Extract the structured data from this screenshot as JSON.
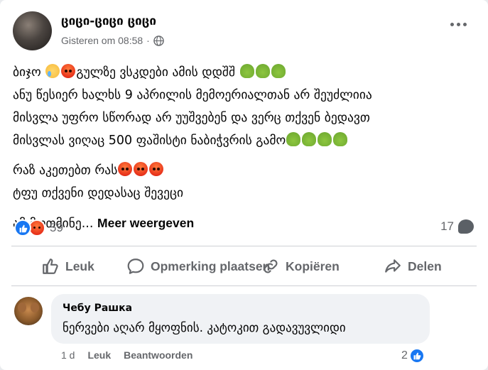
{
  "post": {
    "author": "ციცი-ციცი ციცი",
    "timestamp": "Gisteren om 08:58",
    "separator": "·",
    "privacy_icon": "globe-icon",
    "menu_icon": "more-options-icon",
    "lines": {
      "l1": "ბიჯო",
      "l1b": "გულზე ვსკდები ამის დდშშ",
      "l2": "ანუ წესიერ ხალხს 9 აპრილის მემოერიალთან  არ შეუძლიია",
      "l3": "მისვლა უფრო სწორად არ  უუშვებენ  და ვერც თქვენ ბედავთ",
      "l4": "მისვლას ვიღაც 500 ფაშისტი ნაბიჭვრის გამო",
      "l5": "რაზ აკეთებთ რას",
      "l6": "ტფუ თქვენი დედასაც შევეცი",
      "l7": "ამ მოთმინე...",
      "see_more": "Meer weergeven"
    },
    "reactions": {
      "count": "59",
      "types": [
        "like",
        "angry"
      ]
    },
    "comments_count": "17"
  },
  "actions": {
    "like": "Leuk",
    "comment": "Opmerking plaatsen",
    "copy": "Kopiëren",
    "share": "Delen"
  },
  "comment": {
    "author": "Чебу Рашка",
    "text": "ნერვები აღარ მყოფნის. კატოკით გადავუვლიდი",
    "age": "1 d",
    "like_label": "Leuk",
    "reply_label": "Beantwoorden",
    "like_count": "2"
  }
}
